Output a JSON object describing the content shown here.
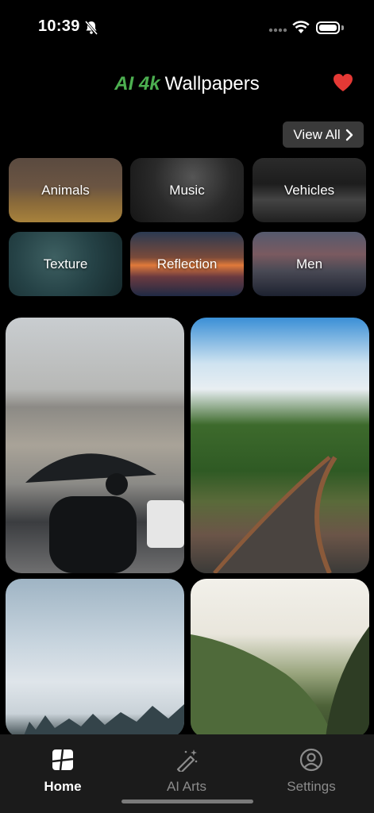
{
  "status_bar": {
    "time": "10:39",
    "icons": [
      "bell-slash-icon",
      "cellular-dots-icon",
      "wifi-icon",
      "battery-icon"
    ]
  },
  "header": {
    "brand_accent": "AI 4k",
    "brand_rest": "Wallpapers",
    "accent_color": "#4caf50",
    "favorite_icon": "heart-icon",
    "favorite_color": "#e53935"
  },
  "view_all": {
    "label": "View All",
    "icon": "chevron-right-icon"
  },
  "categories": [
    {
      "label": "Animals"
    },
    {
      "label": "Music"
    },
    {
      "label": "Vehicles"
    },
    {
      "label": "Texture"
    },
    {
      "label": "Reflection"
    },
    {
      "label": "Men"
    }
  ],
  "tab_bar": {
    "tabs": [
      {
        "label": "Home",
        "icon": "home-icon",
        "selected": true
      },
      {
        "label": "AI Arts",
        "icon": "magic-wand-icon",
        "selected": false
      },
      {
        "label": "Settings",
        "icon": "user-circle-icon",
        "selected": false
      }
    ]
  }
}
